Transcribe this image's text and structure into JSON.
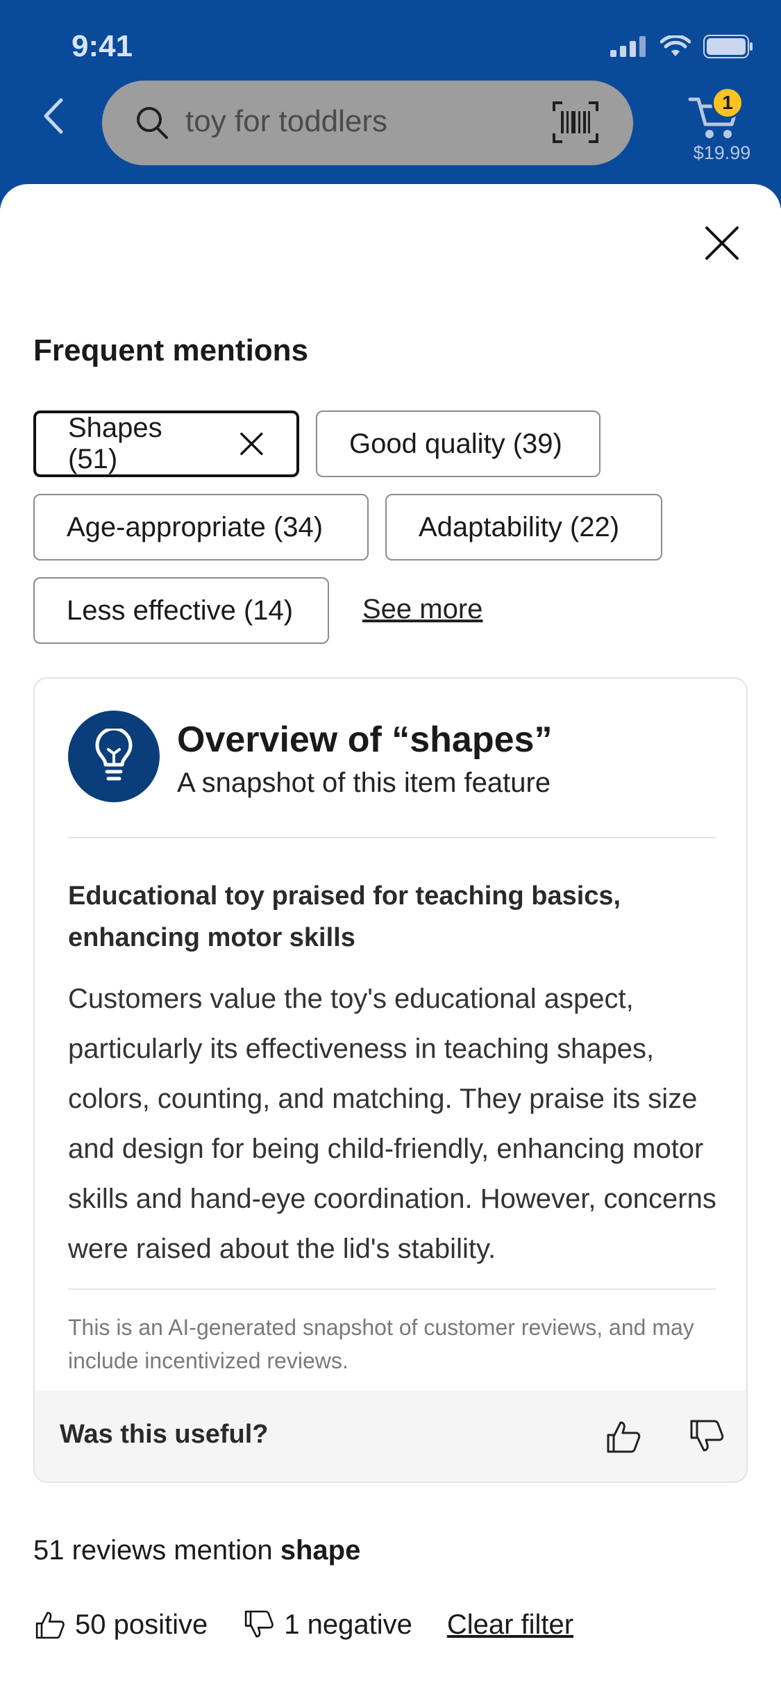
{
  "status_bar": {
    "time": "9:41"
  },
  "header": {
    "search_placeholder": "toy for toddlers",
    "cart_count": "1",
    "cart_total": "$19.99"
  },
  "mentions": {
    "title": "Frequent mentions",
    "chips": [
      {
        "label": "Shapes (51)",
        "selected": true
      },
      {
        "label": "Good quality (39)",
        "selected": false
      },
      {
        "label": "Age-appropriate (34)",
        "selected": false
      },
      {
        "label": "Adaptability (22)",
        "selected": false
      },
      {
        "label": "Less effective (14)",
        "selected": false
      }
    ],
    "see_more": "See more"
  },
  "overview": {
    "title": "Overview of “shapes”",
    "subtitle": "A snapshot of this item feature",
    "headline": "Educational toy praised for teaching basics, enhancing motor skills",
    "body": "Customers value the toy's educational aspect, particularly its effectiveness in teaching shapes, colors, counting, and matching. They praise its size and design for being child-friendly, enhancing motor skills and hand-eye coordination. However, concerns were raised about the lid's stability.",
    "disclaimer": "This is an AI-generated snapshot of customer reviews, and may include incentivized reviews.",
    "feedback_question": "Was this useful?"
  },
  "summary": {
    "count_text": "51 reviews mention ",
    "keyword": "shape",
    "positive": "50 positive",
    "negative": "1 negative",
    "clear_filter": "Clear filter"
  },
  "colors": {
    "header_blue": "#0a4a9a",
    "badge_yellow": "#ffc220",
    "icon_circle": "#0a3e7a"
  }
}
